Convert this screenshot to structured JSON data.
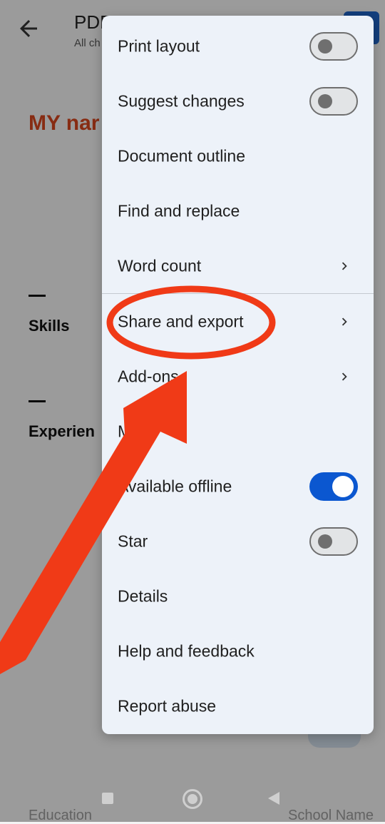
{
  "document": {
    "title": "PDF",
    "subtitle": "All ch",
    "name_heading": "MY nar",
    "sections": [
      {
        "label": "Skills"
      },
      {
        "label": "Experien"
      }
    ],
    "bottom_left_hint": "Education",
    "bottom_right_hint": "School Name"
  },
  "menu": {
    "items": [
      {
        "label": "Print layout",
        "control": "toggle",
        "state": "off"
      },
      {
        "label": "Suggest changes",
        "control": "toggle",
        "state": "off"
      },
      {
        "label": "Document outline",
        "control": "none"
      },
      {
        "label": "Find and replace",
        "control": "none"
      },
      {
        "label": "Word count",
        "control": "chevron"
      },
      {
        "label": "Share and export",
        "control": "chevron"
      },
      {
        "label": "Add-ons",
        "control": "chevron"
      },
      {
        "label": "M",
        "control": "none"
      },
      {
        "label": "Available offline",
        "control": "toggle",
        "state": "on"
      },
      {
        "label": "Star",
        "control": "toggle",
        "state": "off"
      },
      {
        "label": "Details",
        "control": "none"
      },
      {
        "label": "Help and feedback",
        "control": "none"
      },
      {
        "label": "Report abuse",
        "control": "none"
      }
    ]
  },
  "annotation": {
    "color": "#f03a17",
    "highlighted_item": "Share and export",
    "shapes": [
      "ellipse",
      "arrow"
    ]
  },
  "colors": {
    "menu_bg": "#edf2f9",
    "toggle_on": "#0b57d0",
    "accent_text": "#d4461e"
  },
  "icons": [
    "back-arrow-icon",
    "chevron-right-icon",
    "nav-recents-icon",
    "nav-home-icon",
    "nav-back-icon"
  ]
}
